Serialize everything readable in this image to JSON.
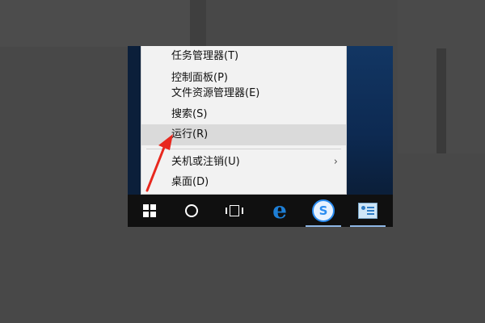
{
  "menu": {
    "items": [
      {
        "label": "任务管理器(T)"
      },
      {
        "label": "控制面板(P)"
      },
      {
        "label": "文件资源管理器(E)"
      },
      {
        "label": "搜索(S)"
      },
      {
        "label": "运行(R)",
        "highlighted": true
      },
      {
        "label": "关机或注销(U)",
        "submenu_arrow": "›"
      },
      {
        "label": "桌面(D)"
      }
    ]
  },
  "taskbar": {
    "items": [
      {
        "icon": "windows-start-icon"
      },
      {
        "icon": "search-circle-icon"
      },
      {
        "icon": "task-view-icon"
      },
      {
        "icon": "edge-browser-icon",
        "glyph": "e"
      },
      {
        "icon": "sogou-icon",
        "glyph": "S",
        "active": true
      },
      {
        "icon": "photo-viewer-icon",
        "active": true
      }
    ]
  },
  "colors": {
    "accent": "#1e7fd6",
    "annotation_arrow": "#e8281e",
    "menu_background": "#f2f2f2",
    "taskbar_background": "#101010"
  }
}
